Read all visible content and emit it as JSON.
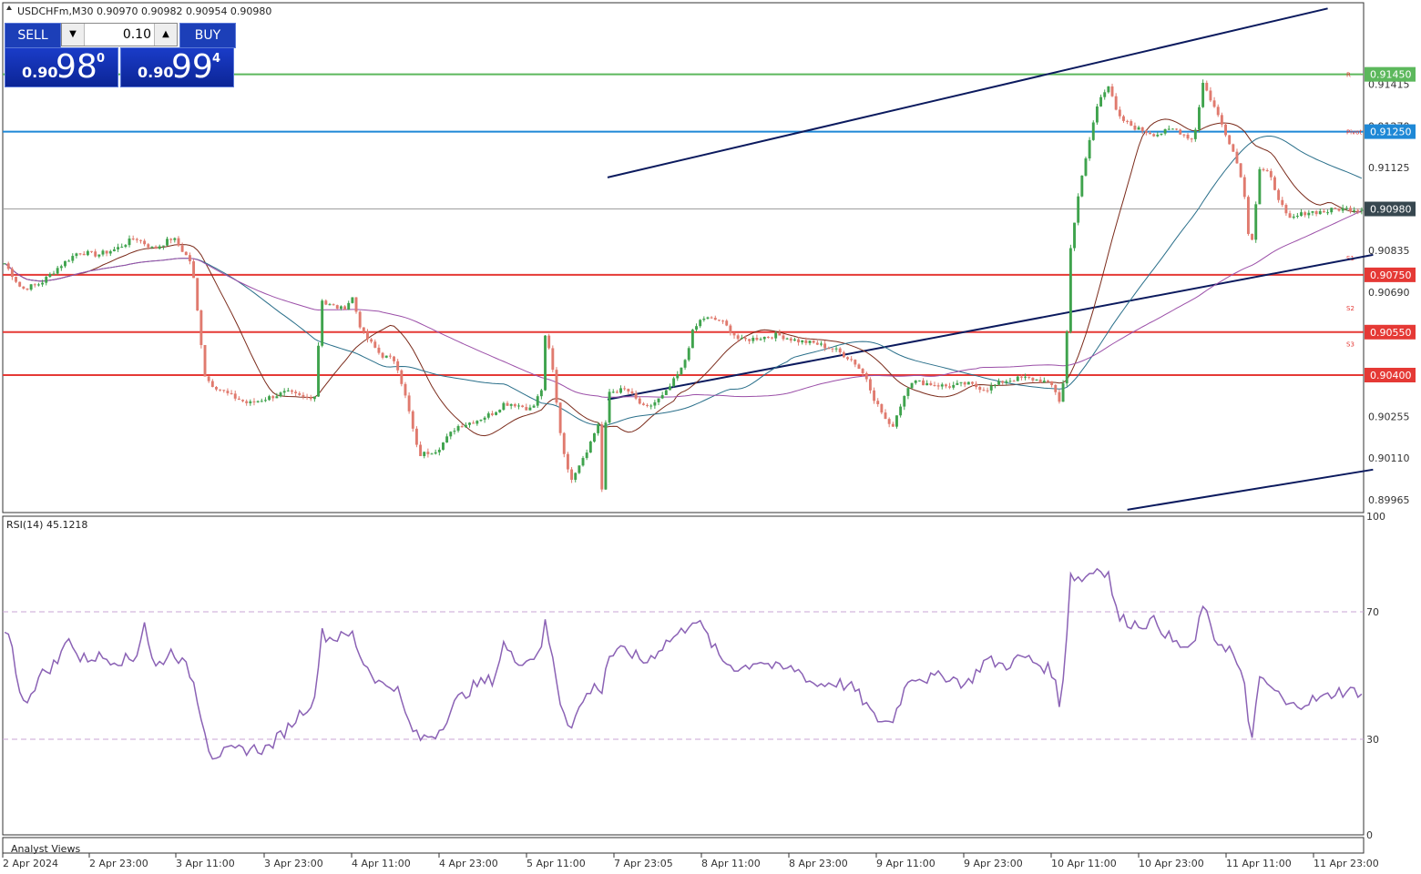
{
  "header": {
    "symbol_text": "USDCHFm,M30  0.90970 0.90982 0.90954 0.90980"
  },
  "trade_panel": {
    "sell_label": "SELL",
    "buy_label": "BUY",
    "lot": "0.10",
    "sell_price_prefix": "0.90",
    "sell_price_big": "98",
    "sell_price_sup": "0",
    "buy_price_prefix": "0.90",
    "buy_price_big": "99",
    "buy_price_sup": "4"
  },
  "chart_data": [
    {
      "type": "candlestick",
      "symbol": "USDCHFm",
      "timeframe": "M30",
      "ylim": [
        0.8992,
        0.917
      ],
      "price_ticks": [
        "0.91415",
        "0.91270",
        "0.91125",
        "0.90835",
        "0.90690",
        "0.90255",
        "0.90110",
        "0.89965"
      ],
      "price_labels": [
        {
          "value": 0.9145,
          "text": "0.91450",
          "color": "#5cb85c"
        },
        {
          "value": 0.9125,
          "text": "0.91250",
          "color": "#1e88d6"
        },
        {
          "value": 0.9098,
          "text": "0.90980",
          "color": "#37474f"
        },
        {
          "value": 0.9075,
          "text": "0.90750",
          "color": "#e53935"
        },
        {
          "value": 0.9055,
          "text": "0.90550",
          "color": "#e53935"
        },
        {
          "value": 0.904,
          "text": "0.90400",
          "color": "#e53935"
        }
      ],
      "horizontal_levels": [
        {
          "value": 0.9145,
          "color": "#5cb85c"
        },
        {
          "value": 0.9125,
          "color": "#1e88d6"
        },
        {
          "value": 0.9098,
          "color": "#9e9e9e"
        },
        {
          "value": 0.9075,
          "color": "#e53935"
        },
        {
          "value": 0.9055,
          "color": "#e53935"
        },
        {
          "value": 0.904,
          "color": "#e53935"
        }
      ],
      "level_tags": [
        {
          "value": 0.9145,
          "text": "R"
        },
        {
          "value": 0.9125,
          "text": "Pivot"
        },
        {
          "value": 0.9081,
          "text": "S1"
        },
        {
          "value": 0.90635,
          "text": "S2"
        },
        {
          "value": 0.9051,
          "text": "S3"
        }
      ],
      "trendlines": [
        {
          "x1": 31.5,
          "y1": 0.9109,
          "x2": 69.6,
          "y2": 0.9168
        },
        {
          "x1": 31.5,
          "y1": 0.90315,
          "x2": 72.0,
          "y2": 0.9082
        },
        {
          "x1": 59.0,
          "y1": 0.8993,
          "x2": 72.0,
          "y2": 0.9007
        }
      ],
      "x_ticks": [
        "2 Apr 2024",
        "2 Apr 23:00",
        "3 Apr 11:00",
        "3 Apr 23:00",
        "4 Apr 11:00",
        "4 Apr 23:00",
        "5 Apr 11:00",
        "7 Apr 23:05",
        "8 Apr 11:00",
        "8 Apr 23:00",
        "9 Apr 11:00",
        "9 Apr 23:00",
        "10 Apr 11:00",
        "10 Apr 23:00",
        "11 Apr 11:00",
        "11 Apr 23:00"
      ],
      "close_keypoints": [
        [
          0,
          0.908
        ],
        [
          1,
          0.907
        ],
        [
          2,
          0.9072
        ],
        [
          3,
          0.9078
        ],
        [
          4,
          0.9083
        ],
        [
          5,
          0.9082
        ],
        [
          6,
          0.9084
        ],
        [
          7,
          0.9088
        ],
        [
          8,
          0.9084
        ],
        [
          9,
          0.9088
        ],
        [
          10,
          0.9079
        ],
        [
          10.7,
          0.904
        ],
        [
          11,
          0.9037
        ],
        [
          12,
          0.9033
        ],
        [
          13,
          0.903
        ],
        [
          14,
          0.9032
        ],
        [
          15,
          0.9034
        ],
        [
          16,
          0.9032
        ],
        [
          16.6,
          0.9033
        ],
        [
          16.8,
          0.9068
        ],
        [
          17,
          0.9065
        ],
        [
          18,
          0.9063
        ],
        [
          18.5,
          0.9067
        ],
        [
          19,
          0.9055
        ],
        [
          20,
          0.9047
        ],
        [
          20.8,
          0.9045
        ],
        [
          21.4,
          0.903
        ],
        [
          22,
          0.9012
        ],
        [
          23,
          0.9014
        ],
        [
          24,
          0.9022
        ],
        [
          25,
          0.9024
        ],
        [
          26,
          0.9027
        ],
        [
          26.5,
          0.903
        ],
        [
          27,
          0.903
        ],
        [
          28,
          0.9028
        ],
        [
          28.5,
          0.9035
        ],
        [
          28.7,
          0.9053
        ],
        [
          29,
          0.9047
        ],
        [
          29.5,
          0.902
        ],
        [
          30,
          0.9003
        ],
        [
          31,
          0.9015
        ],
        [
          31.5,
          0.9023
        ],
        [
          31.7,
          0.9
        ],
        [
          32,
          0.9034
        ],
        [
          33,
          0.9035
        ],
        [
          34,
          0.9028
        ],
        [
          35,
          0.9033
        ],
        [
          36,
          0.9043
        ],
        [
          36.5,
          0.9055
        ],
        [
          37,
          0.906
        ],
        [
          38,
          0.9059
        ],
        [
          39,
          0.9052
        ],
        [
          40,
          0.9053
        ],
        [
          41,
          0.9054
        ],
        [
          42,
          0.9052
        ],
        [
          43,
          0.9051
        ],
        [
          44,
          0.9049
        ],
        [
          45,
          0.9045
        ],
        [
          45.8,
          0.9038
        ],
        [
          46,
          0.9033
        ],
        [
          47,
          0.9021
        ],
        [
          48,
          0.9038
        ],
        [
          49,
          0.9037
        ],
        [
          50,
          0.9036
        ],
        [
          51,
          0.9037
        ],
        [
          52,
          0.9035
        ],
        [
          53,
          0.9038
        ],
        [
          54,
          0.9039
        ],
        [
          55,
          0.9038
        ],
        [
          55.6,
          0.9036
        ],
        [
          55.9,
          0.9031
        ],
        [
          56.2,
          0.904
        ],
        [
          56.5,
          0.9085
        ],
        [
          57,
          0.9106
        ],
        [
          57.5,
          0.9122
        ],
        [
          58,
          0.9137
        ],
        [
          58.5,
          0.9141
        ],
        [
          59,
          0.913
        ],
        [
          60,
          0.9126
        ],
        [
          61,
          0.9124
        ],
        [
          62,
          0.9126
        ],
        [
          63,
          0.9122
        ],
        [
          63.5,
          0.9142
        ],
        [
          64,
          0.9135
        ],
        [
          65,
          0.912
        ],
        [
          65.5,
          0.911
        ],
        [
          65.8,
          0.9098
        ],
        [
          66,
          0.9082
        ],
        [
          66.5,
          0.9112
        ],
        [
          67,
          0.911
        ],
        [
          67.5,
          0.9102
        ],
        [
          68,
          0.9094
        ],
        [
          69,
          0.9097
        ],
        [
          70,
          0.9097
        ],
        [
          70.5,
          0.9098
        ],
        [
          71,
          0.9098
        ]
      ],
      "indicators": [
        "moving-average-brown",
        "moving-average-teal",
        "moving-average-purple"
      ]
    },
    {
      "type": "line",
      "title": "RSI(14) 45.1218",
      "ylim": [
        0,
        100
      ],
      "y_ticks": [
        "100",
        "70",
        "30",
        "0"
      ],
      "reference_levels": [
        70,
        30
      ],
      "keypoints": [
        [
          0,
          66
        ],
        [
          0.5,
          60
        ],
        [
          1,
          40
        ],
        [
          2,
          50
        ],
        [
          3,
          55
        ],
        [
          3.5,
          63
        ],
        [
          4,
          55
        ],
        [
          5,
          56
        ],
        [
          6,
          55
        ],
        [
          7,
          55
        ],
        [
          7.5,
          67
        ],
        [
          8,
          52
        ],
        [
          9,
          58
        ],
        [
          10,
          50
        ],
        [
          10.7,
          33
        ],
        [
          11,
          25
        ],
        [
          12,
          26
        ],
        [
          13,
          27
        ],
        [
          14,
          27
        ],
        [
          15,
          33
        ],
        [
          16,
          40
        ],
        [
          16.6,
          42
        ],
        [
          16.8,
          67
        ],
        [
          17,
          62
        ],
        [
          18,
          62
        ],
        [
          18.5,
          63
        ],
        [
          19,
          55
        ],
        [
          20,
          47
        ],
        [
          20.8,
          47
        ],
        [
          21.4,
          36
        ],
        [
          22,
          30
        ],
        [
          23,
          32
        ],
        [
          24,
          42
        ],
        [
          25,
          47
        ],
        [
          26,
          49
        ],
        [
          26.5,
          60
        ],
        [
          27,
          55
        ],
        [
          28,
          55
        ],
        [
          28.5,
          60
        ],
        [
          28.7,
          66
        ],
        [
          29,
          58
        ],
        [
          29.5,
          42
        ],
        [
          30,
          34
        ],
        [
          31,
          45
        ],
        [
          31.5,
          47
        ],
        [
          31.7,
          45
        ],
        [
          32,
          56
        ],
        [
          33,
          58
        ],
        [
          34,
          54
        ],
        [
          35,
          60
        ],
        [
          36,
          64
        ],
        [
          36.5,
          68
        ],
        [
          37,
          65
        ],
        [
          38,
          55
        ],
        [
          39,
          52
        ],
        [
          40,
          55
        ],
        [
          41,
          52
        ],
        [
          42,
          52
        ],
        [
          43,
          47
        ],
        [
          44,
          48
        ],
        [
          45,
          46
        ],
        [
          45.8,
          40
        ],
        [
          46,
          37
        ],
        [
          47,
          35
        ],
        [
          48,
          50
        ],
        [
          49,
          49
        ],
        [
          50,
          50
        ],
        [
          51,
          47
        ],
        [
          52,
          55
        ],
        [
          53,
          53
        ],
        [
          54,
          56
        ],
        [
          55,
          53
        ],
        [
          55.6,
          51
        ],
        [
          55.9,
          40
        ],
        [
          56.2,
          55
        ],
        [
          56.5,
          82
        ],
        [
          57,
          80
        ],
        [
          57.5,
          82
        ],
        [
          58,
          84
        ],
        [
          58.5,
          82
        ],
        [
          59,
          68
        ],
        [
          60,
          66
        ],
        [
          61,
          67
        ],
        [
          62,
          60
        ],
        [
          63,
          58
        ],
        [
          63.5,
          73
        ],
        [
          64,
          62
        ],
        [
          65,
          58
        ],
        [
          65.5,
          50
        ],
        [
          65.8,
          44
        ],
        [
          66,
          28
        ],
        [
          66.5,
          48
        ],
        [
          67,
          47
        ],
        [
          67.5,
          44
        ],
        [
          68,
          40
        ],
        [
          69,
          42
        ],
        [
          70,
          43
        ],
        [
          70.5,
          45
        ],
        [
          71,
          45
        ]
      ]
    }
  ],
  "footer": {
    "analyst_views": "Analyst Views"
  }
}
